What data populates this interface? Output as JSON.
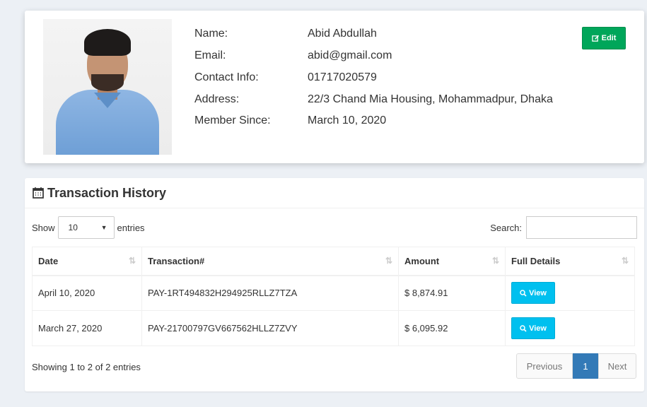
{
  "profile": {
    "fields": [
      {
        "label": "Name:",
        "value": "Abid Abdullah"
      },
      {
        "label": "Email:",
        "value": "abid@gmail.com"
      },
      {
        "label": "Contact Info:",
        "value": "01717020579"
      },
      {
        "label": "Address:",
        "value": "22/3 Chand Mia Housing, Mohammadpur, Dhaka"
      },
      {
        "label": "Member Since:",
        "value": "March 10, 2020"
      }
    ],
    "edit_label": "Edit"
  },
  "transactions": {
    "title": "Transaction History",
    "show_label": "Show",
    "page_size": "10",
    "entries_label": "entries",
    "search_label": "Search:",
    "columns": [
      "Date",
      "Transaction#",
      "Amount",
      "Full Details"
    ],
    "rows": [
      {
        "date": "April 10, 2020",
        "transaction": "PAY-1RT494832H294925RLLZ7TZA",
        "amount": "$ 8,874.91",
        "action": "View"
      },
      {
        "date": "March 27, 2020",
        "transaction": "PAY-21700797GV667562HLLZ7ZVY",
        "amount": "$ 6,095.92",
        "action": "View"
      }
    ],
    "info": "Showing 1 to 2 of 2 entries",
    "pagination": {
      "previous": "Previous",
      "current": "1",
      "next": "Next"
    }
  },
  "colors": {
    "edit": "#00a65a",
    "view": "#00c0ef",
    "active_page": "#337ab7"
  },
  "icons": [
    "edit-icon",
    "calendar-icon",
    "search-icon",
    "sort-icon",
    "dropdown-arrow-icon"
  ]
}
